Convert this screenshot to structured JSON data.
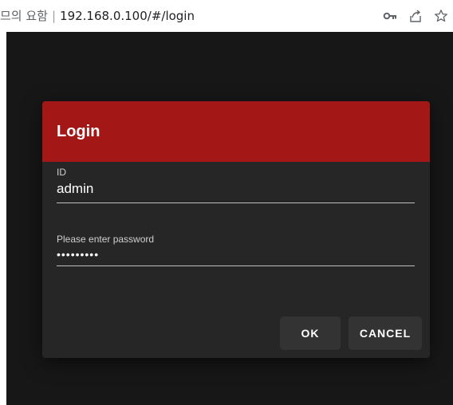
{
  "browser": {
    "tab_text_prefix": "므의 요함",
    "separator": "|",
    "url": "192.168.0.100/#/login",
    "icons": [
      "key-icon",
      "share-icon",
      "star-icon"
    ]
  },
  "dialog": {
    "title": "Login",
    "id_field": {
      "label": "ID",
      "value": "admin"
    },
    "password_field": {
      "label": "Please enter password",
      "value": "•••••••••"
    },
    "buttons": {
      "ok": "OK",
      "cancel": "CANCEL"
    }
  },
  "colors": {
    "header": "#a31717",
    "dialog_bg": "#262626",
    "backdrop": "#171717",
    "button_bg": "#333333"
  }
}
